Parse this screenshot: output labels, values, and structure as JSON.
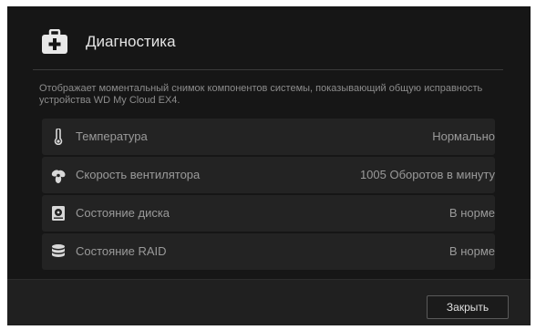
{
  "dialog": {
    "title": "Диагностика",
    "description": "Отображает моментальный снимок компонентов системы, показывающий общую исправность устройства WD My Cloud EX4.",
    "rows": [
      {
        "icon": "thermometer-icon",
        "label": "Температура",
        "value": "Нормально"
      },
      {
        "icon": "fan-icon",
        "label": "Скорость вентилятора",
        "value": "1005 Оборотов в минуту"
      },
      {
        "icon": "hard-disk-icon",
        "label": "Состояние диска",
        "value": "В норме"
      },
      {
        "icon": "raid-database-icon",
        "label": "Состояние RAID",
        "value": "В норме"
      }
    ],
    "close_label": "Закрыть"
  },
  "colors": {
    "dialog_bg": "#161616",
    "row_bg": "#232323",
    "footer_bg": "#202020",
    "text_primary": "#e4e4e4",
    "text_secondary": "#9a9a9a"
  },
  "header": {
    "icon": "first-aid-kit-icon"
  }
}
